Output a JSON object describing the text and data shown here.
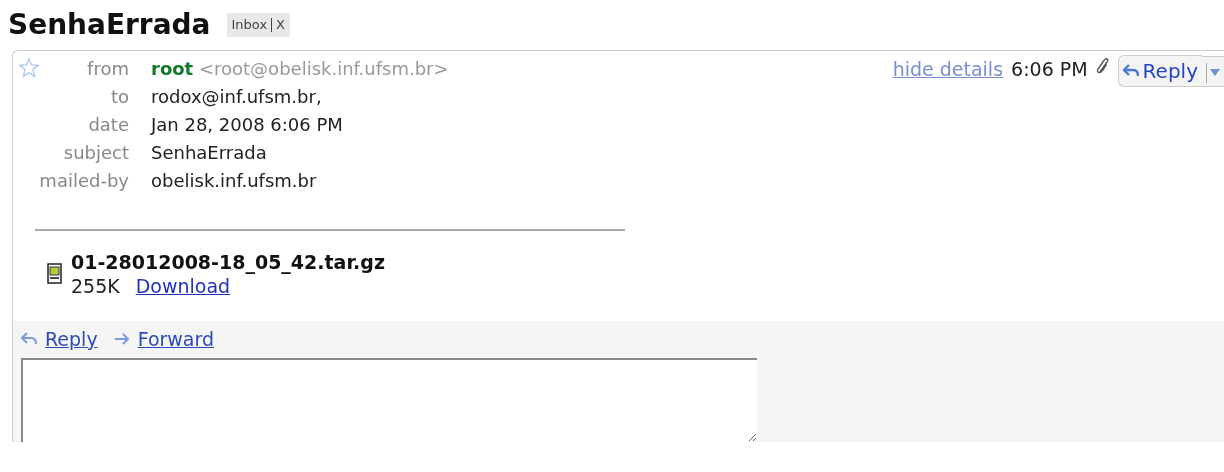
{
  "subject": "SenhaErrada",
  "label": {
    "text": "Inbox",
    "remove": "X"
  },
  "message": {
    "starred": false,
    "headers": [
      {
        "kind": "sender",
        "label": "from",
        "name": "root",
        "value": "<root@obelisk.inf.ufsm.br>"
      },
      {
        "kind": "plain",
        "label": "to",
        "value": "rodox@inf.ufsm.br,"
      },
      {
        "kind": "plain",
        "label": "date",
        "value": "Jan 28, 2008 6:06 PM"
      },
      {
        "kind": "plain",
        "label": "subject",
        "value": "SenhaErrada"
      },
      {
        "kind": "plain",
        "label": "mailed-by",
        "value": "obelisk.inf.ufsm.br"
      }
    ],
    "hide_details": "hide details",
    "time": "6:06 PM",
    "has_attachment": true,
    "reply_button": "Reply",
    "attachment": {
      "filename": "01-28012008-18_05_42.tar.gz",
      "size": "255K",
      "download": "Download"
    },
    "footer_actions": [
      {
        "kind": "reply",
        "label": "Reply"
      },
      {
        "kind": "forward",
        "label": "Forward"
      }
    ]
  }
}
